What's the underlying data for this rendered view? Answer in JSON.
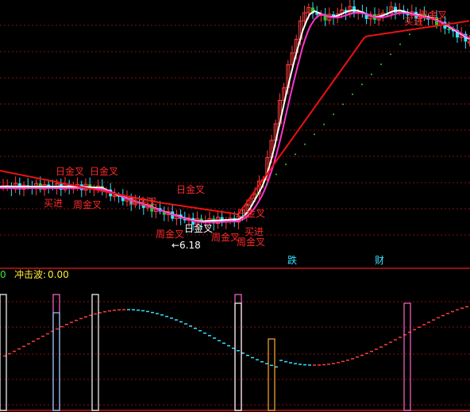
{
  "colors": {
    "background": "#000000",
    "grid": "#8a1010",
    "separator": "#c01818",
    "bull": "#ff3b3b",
    "bear": "#33e1ff",
    "bearBody": "#2cc42c",
    "ma_white": "#ffffff",
    "ma_magenta": "#ff33cc",
    "ma_red": "#ee1111",
    "dots": "#33cc33",
    "label_red": "#ff2a2a",
    "label_white": "#ffffff",
    "sub_yellow": "#ffee33",
    "sub_green": "#33ee33"
  },
  "labels": {
    "ri_jin_cha": "日金叉",
    "zhou_jin_cha": "周金叉",
    "mai_jin": "买进",
    "die": "跌",
    "cai": "财",
    "low_mark": "←6.18",
    "indicator_name": "冲击波:",
    "indicator_value": "0.00",
    "left_zero": "0"
  },
  "chart_data": {
    "type": "candlestick",
    "panels": [
      "price",
      "impact-wave"
    ],
    "price_low_marker": 6.18,
    "indicator": {
      "name": "冲击波",
      "value": 0.0
    },
    "signals": [
      "日金叉",
      "周金叉",
      "买进",
      "跌",
      "财"
    ]
  }
}
